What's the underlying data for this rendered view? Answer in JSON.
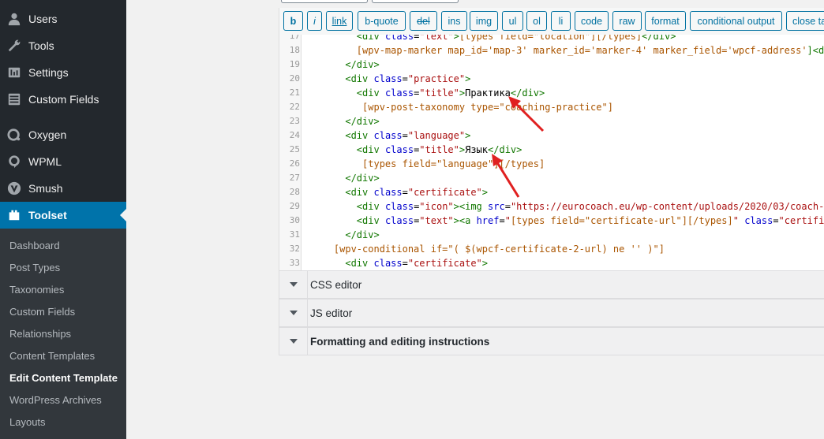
{
  "sidebar": {
    "menu": [
      {
        "label": "Users",
        "icon": "users-icon"
      },
      {
        "label": "Tools",
        "icon": "wrench-icon"
      },
      {
        "label": "Settings",
        "icon": "settings-icon"
      },
      {
        "label": "Custom Fields",
        "icon": "custom-fields-icon"
      },
      {
        "label": "Oxygen",
        "icon": "oxygen-icon"
      },
      {
        "label": "WPML",
        "icon": "wpml-icon"
      },
      {
        "label": "Smush",
        "icon": "smush-icon"
      },
      {
        "label": "Toolset",
        "icon": "toolset-icon"
      }
    ],
    "submenu": [
      {
        "label": "Dashboard"
      },
      {
        "label": "Post Types"
      },
      {
        "label": "Taxonomies"
      },
      {
        "label": "Custom Fields"
      },
      {
        "label": "Relationships"
      },
      {
        "label": "Content Templates"
      },
      {
        "label": "Edit Content Template"
      },
      {
        "label": "WordPress Archives"
      },
      {
        "label": "Layouts"
      }
    ]
  },
  "toolbar": {
    "buttons": [
      "b",
      "i",
      "link",
      "b-quote",
      "del",
      "ins",
      "img",
      "ul",
      "ol",
      "li",
      "code",
      "raw",
      "format",
      "conditional output",
      "close tags"
    ]
  },
  "editor": {
    "lines": [
      {
        "n": "17",
        "html": "        <span class=\"tag\">&lt;div</span> <span class=\"att\">class</span>=<span class=\"str\">\"text\"</span><span class=\"tag\">&gt;</span><span class=\"sc\">[types field=\"location\"][/types]</span><span class=\"tag\">&lt;/div&gt;</span>"
      },
      {
        "n": "18",
        "html": "        <span class=\"sc\">[wpv-map-marker map_id='map-3' marker_id='marker-4' marker_field='wpcf-address'</span><span class=\"tag\">]&lt;d</span>"
      },
      {
        "n": "19",
        "html": "      <span class=\"tag\">&lt;/div&gt;</span>"
      },
      {
        "n": "20",
        "html": "      <span class=\"tag\">&lt;div</span> <span class=\"att\">class</span>=<span class=\"str\">\"practice\"</span><span class=\"tag\">&gt;</span>"
      },
      {
        "n": "21",
        "html": "        <span class=\"tag\">&lt;div</span> <span class=\"att\">class</span>=<span class=\"str\">\"title\"</span><span class=\"tag\">&gt;</span><span class=\"txt\">Практика</span><span class=\"tag\">&lt;/div&gt;</span>"
      },
      {
        "n": "22",
        "html": "         <span class=\"sc\">[wpv-post-taxonomy type=\"coaching-practice\"]</span>"
      },
      {
        "n": "23",
        "html": "      <span class=\"tag\">&lt;/div&gt;</span>"
      },
      {
        "n": "24",
        "html": "      <span class=\"tag\">&lt;div</span> <span class=\"att\">class</span>=<span class=\"str\">\"language\"</span><span class=\"tag\">&gt;</span>"
      },
      {
        "n": "25",
        "html": "        <span class=\"tag\">&lt;div</span> <span class=\"att\">class</span>=<span class=\"str\">\"title\"</span><span class=\"tag\">&gt;</span><span class=\"txt\">Язык</span><span class=\"tag\">&lt;/div&gt;</span>"
      },
      {
        "n": "26",
        "html": "         <span class=\"sc\">[types field=\"language\"][/types]</span>"
      },
      {
        "n": "27",
        "html": "      <span class=\"tag\">&lt;/div&gt;</span>"
      },
      {
        "n": "28",
        "html": "      <span class=\"tag\">&lt;div</span> <span class=\"att\">class</span>=<span class=\"str\">\"certificate\"</span><span class=\"tag\">&gt;</span>"
      },
      {
        "n": "29",
        "html": "        <span class=\"tag\">&lt;div</span> <span class=\"att\">class</span>=<span class=\"str\">\"icon\"</span><span class=\"tag\">&gt;&lt;img</span> <span class=\"att\">src</span>=<span class=\"str\">\"https://eurocoach.eu/wp-content/uploads/2020/03/coach-</span>"
      },
      {
        "n": "30",
        "html": "        <span class=\"tag\">&lt;div</span> <span class=\"att\">class</span>=<span class=\"str\">\"text\"</span><span class=\"tag\">&gt;&lt;a</span> <span class=\"att\">href</span>=<span class=\"str\">\"</span><span class=\"sc\">[types field=\"certificate-url\"][/types]</span><span class=\"str\">\"</span> <span class=\"att\">class</span>=<span class=\"str\">\"certifi</span>"
      },
      {
        "n": "31",
        "html": "      <span class=\"tag\">&lt;/div&gt;</span>"
      },
      {
        "n": "32",
        "html": "    <span class=\"sc\">[wpv-conditional if=\"( $(wpcf-certificate-2-url) ne '' )\"]</span>"
      },
      {
        "n": "33",
        "html": "      <span class=\"tag\">&lt;div</span> <span class=\"att\">class</span>=<span class=\"str\">\"certificate\"</span><span class=\"tag\">&gt;</span>"
      }
    ]
  },
  "panels": {
    "css": "CSS editor",
    "js": "JS editor",
    "format": "Formatting and editing instructions"
  },
  "colors": {
    "sidebar_bg": "#23282d",
    "submenu_bg": "#32373c",
    "active_bg": "#0073aa",
    "button_border": "#0071a1",
    "arrow": "#e02020"
  }
}
